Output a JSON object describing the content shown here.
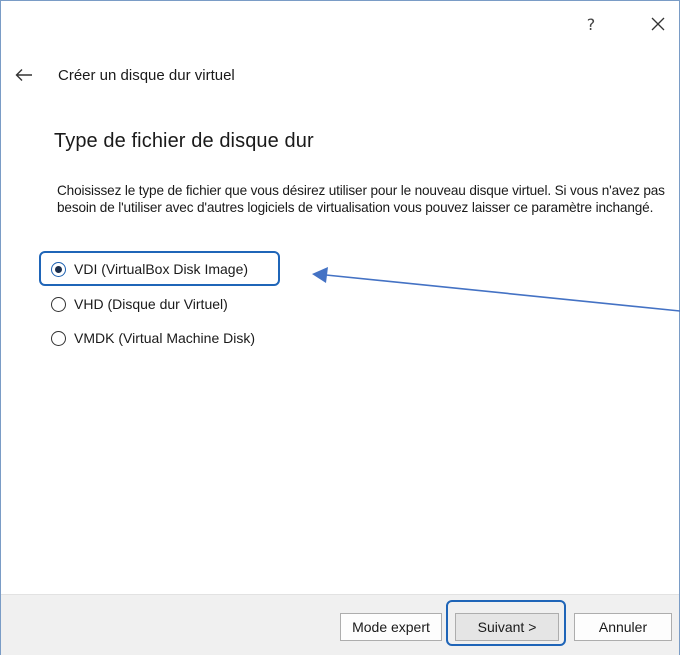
{
  "window": {
    "help_label": "?",
    "close_icon": "close-icon"
  },
  "header": {
    "back_icon": "arrow-left-icon",
    "title": "Créer un disque dur virtuel"
  },
  "page": {
    "heading": "Type de fichier de disque dur",
    "description": "Choisissez le type de fichier que vous désirez utiliser pour le nouveau disque virtuel. Si vous n'avez pas besoin de l'utiliser avec d'autres logiciels de virtualisation vous pouvez laisser ce paramètre inchangé."
  },
  "options": [
    {
      "label": "VDI (VirtualBox Disk Image)",
      "selected": true
    },
    {
      "label": "VHD (Disque dur Virtuel)",
      "selected": false
    },
    {
      "label": "VMDK (Virtual Machine Disk)",
      "selected": false
    }
  ],
  "footer": {
    "expert_label": "Mode expert",
    "next_label": "Suivant >",
    "cancel_label": "Annuler"
  },
  "annotation": {
    "highlight_color": "#1f65b8",
    "arrow_color": "#4472c4"
  }
}
